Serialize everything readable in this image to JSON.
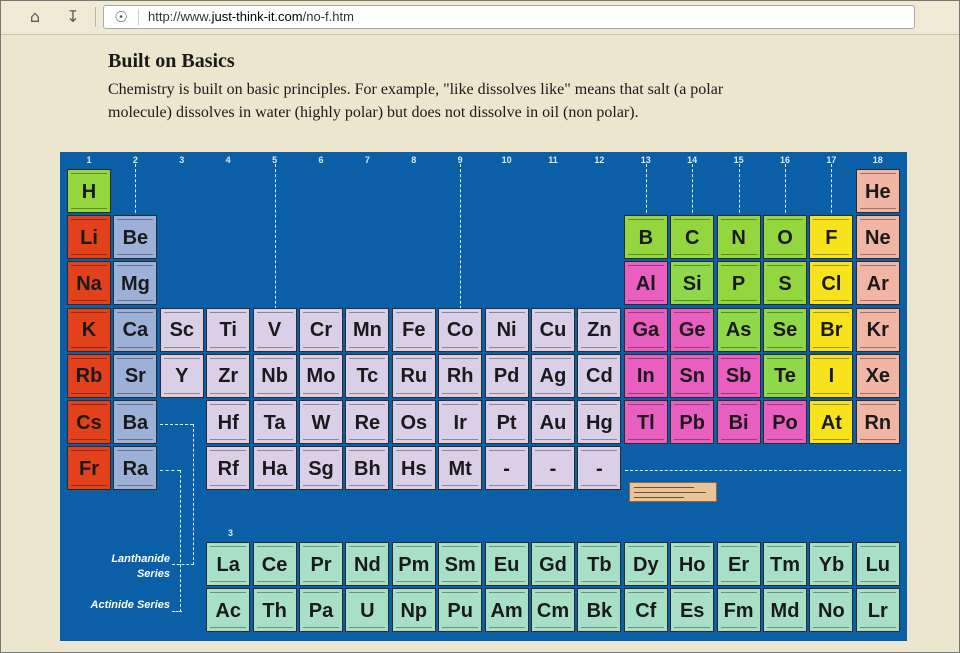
{
  "browser": {
    "url_prefix": "http://www.",
    "url_domain": "just-think-it.com",
    "url_path": "/no-f.htm"
  },
  "article": {
    "title": "Built on Basics",
    "paragraph": "Chemistry is built on basic principles. For example, \"like dissolves like\" means that salt (a polar molecule) dissolves in water (highly polar) but does not dissolve in oil (non polar)."
  },
  "periodic_table": {
    "group_numbers": [
      "1",
      "2",
      "3",
      "4",
      "5",
      "6",
      "7",
      "8",
      "9",
      "10",
      "11",
      "12",
      "13",
      "14",
      "15",
      "16",
      "17",
      "18"
    ],
    "lanthanide_group_number": "3",
    "series_labels": {
      "lanthanide": "Lanthanide Series",
      "actinide": "Actinide Series"
    },
    "colors": {
      "alkali": "#e2411b",
      "alkaline_earth": "#9db0d8",
      "transition": "#d9cfe7",
      "nonmetal": "#93d63e",
      "metalloid": "#8fd84a",
      "halogen": "#f7e21c",
      "noble_gas": "#f0b5a3",
      "post_transition": "#e85fbf",
      "lanthanide_actinide": "#a8e0c7",
      "background": "#0a5fa6"
    },
    "rows": [
      [
        {
          "s": "H",
          "c": "nonmetal",
          "g": 1
        },
        {
          "s": "He",
          "c": "noble_gas",
          "g": 18
        }
      ],
      [
        {
          "s": "Li",
          "c": "alkali",
          "g": 1
        },
        {
          "s": "Be",
          "c": "alkaline_earth",
          "g": 2
        },
        {
          "s": "B",
          "c": "nonmetal",
          "g": 13
        },
        {
          "s": "C",
          "c": "nonmetal",
          "g": 14
        },
        {
          "s": "N",
          "c": "nonmetal",
          "g": 15
        },
        {
          "s": "O",
          "c": "nonmetal",
          "g": 16
        },
        {
          "s": "F",
          "c": "halogen",
          "g": 17
        },
        {
          "s": "Ne",
          "c": "noble_gas",
          "g": 18
        }
      ],
      [
        {
          "s": "Na",
          "c": "alkali",
          "g": 1
        },
        {
          "s": "Mg",
          "c": "alkaline_earth",
          "g": 2
        },
        {
          "s": "Al",
          "c": "post_transition",
          "g": 13
        },
        {
          "s": "Si",
          "c": "metalloid",
          "g": 14
        },
        {
          "s": "P",
          "c": "nonmetal",
          "g": 15
        },
        {
          "s": "S",
          "c": "nonmetal",
          "g": 16
        },
        {
          "s": "Cl",
          "c": "halogen",
          "g": 17
        },
        {
          "s": "Ar",
          "c": "noble_gas",
          "g": 18
        }
      ],
      [
        {
          "s": "K",
          "c": "alkali",
          "g": 1
        },
        {
          "s": "Ca",
          "c": "alkaline_earth",
          "g": 2
        },
        {
          "s": "Sc",
          "c": "transition",
          "g": 3
        },
        {
          "s": "Ti",
          "c": "transition",
          "g": 4
        },
        {
          "s": "V",
          "c": "transition",
          "g": 5
        },
        {
          "s": "Cr",
          "c": "transition",
          "g": 6
        },
        {
          "s": "Mn",
          "c": "transition",
          "g": 7
        },
        {
          "s": "Fe",
          "c": "transition",
          "g": 8
        },
        {
          "s": "Co",
          "c": "transition",
          "g": 9
        },
        {
          "s": "Ni",
          "c": "transition",
          "g": 10
        },
        {
          "s": "Cu",
          "c": "transition",
          "g": 11
        },
        {
          "s": "Zn",
          "c": "transition",
          "g": 12
        },
        {
          "s": "Ga",
          "c": "post_transition",
          "g": 13
        },
        {
          "s": "Ge",
          "c": "post_transition",
          "g": 14
        },
        {
          "s": "As",
          "c": "metalloid",
          "g": 15
        },
        {
          "s": "Se",
          "c": "metalloid",
          "g": 16
        },
        {
          "s": "Br",
          "c": "halogen",
          "g": 17
        },
        {
          "s": "Kr",
          "c": "noble_gas",
          "g": 18
        }
      ],
      [
        {
          "s": "Rb",
          "c": "alkali",
          "g": 1
        },
        {
          "s": "Sr",
          "c": "alkaline_earth",
          "g": 2
        },
        {
          "s": "Y",
          "c": "transition",
          "g": 3
        },
        {
          "s": "Zr",
          "c": "transition",
          "g": 4
        },
        {
          "s": "Nb",
          "c": "transition",
          "g": 5
        },
        {
          "s": "Mo",
          "c": "transition",
          "g": 6
        },
        {
          "s": "Tc",
          "c": "transition",
          "g": 7
        },
        {
          "s": "Ru",
          "c": "transition",
          "g": 8
        },
        {
          "s": "Rh",
          "c": "transition",
          "g": 9
        },
        {
          "s": "Pd",
          "c": "transition",
          "g": 10
        },
        {
          "s": "Ag",
          "c": "transition",
          "g": 11
        },
        {
          "s": "Cd",
          "c": "transition",
          "g": 12
        },
        {
          "s": "In",
          "c": "post_transition",
          "g": 13
        },
        {
          "s": "Sn",
          "c": "post_transition",
          "g": 14
        },
        {
          "s": "Sb",
          "c": "post_transition",
          "g": 15
        },
        {
          "s": "Te",
          "c": "metalloid",
          "g": 16
        },
        {
          "s": "I",
          "c": "halogen",
          "g": 17
        },
        {
          "s": "Xe",
          "c": "noble_gas",
          "g": 18
        }
      ],
      [
        {
          "s": "Cs",
          "c": "alkali",
          "g": 1
        },
        {
          "s": "Ba",
          "c": "alkaline_earth",
          "g": 2
        },
        {
          "s": "Hf",
          "c": "transition",
          "g": 4
        },
        {
          "s": "Ta",
          "c": "transition",
          "g": 5
        },
        {
          "s": "W",
          "c": "transition",
          "g": 6
        },
        {
          "s": "Re",
          "c": "transition",
          "g": 7
        },
        {
          "s": "Os",
          "c": "transition",
          "g": 8
        },
        {
          "s": "Ir",
          "c": "transition",
          "g": 9
        },
        {
          "s": "Pt",
          "c": "transition",
          "g": 10
        },
        {
          "s": "Au",
          "c": "transition",
          "g": 11
        },
        {
          "s": "Hg",
          "c": "transition",
          "g": 12
        },
        {
          "s": "Tl",
          "c": "post_transition",
          "g": 13
        },
        {
          "s": "Pb",
          "c": "post_transition",
          "g": 14
        },
        {
          "s": "Bi",
          "c": "post_transition",
          "g": 15
        },
        {
          "s": "Po",
          "c": "post_transition",
          "g": 16
        },
        {
          "s": "At",
          "c": "halogen",
          "g": 17
        },
        {
          "s": "Rn",
          "c": "noble_gas",
          "g": 18
        }
      ],
      [
        {
          "s": "Fr",
          "c": "alkali",
          "g": 1
        },
        {
          "s": "Ra",
          "c": "alkaline_earth",
          "g": 2
        },
        {
          "s": "Rf",
          "c": "transition",
          "g": 4
        },
        {
          "s": "Ha",
          "c": "transition",
          "g": 5
        },
        {
          "s": "Sg",
          "c": "transition",
          "g": 6
        },
        {
          "s": "Bh",
          "c": "transition",
          "g": 7
        },
        {
          "s": "Hs",
          "c": "transition",
          "g": 8
        },
        {
          "s": "Mt",
          "c": "transition",
          "g": 9
        },
        {
          "s": "-",
          "c": "transition",
          "g": 10
        },
        {
          "s": "-",
          "c": "transition",
          "g": 11
        },
        {
          "s": "-",
          "c": "transition",
          "g": 12
        }
      ]
    ],
    "lanthanides": [
      "La",
      "Ce",
      "Pr",
      "Nd",
      "Pm",
      "Sm",
      "Eu",
      "Gd",
      "Tb",
      "Dy",
      "Ho",
      "Er",
      "Tm",
      "Yb",
      "Lu"
    ],
    "actinides": [
      "Ac",
      "Th",
      "Pa",
      "U",
      "Np",
      "Pu",
      "Am",
      "Cm",
      "Bk",
      "Cf",
      "Es",
      "Fm",
      "Md",
      "No",
      "Lr"
    ]
  }
}
